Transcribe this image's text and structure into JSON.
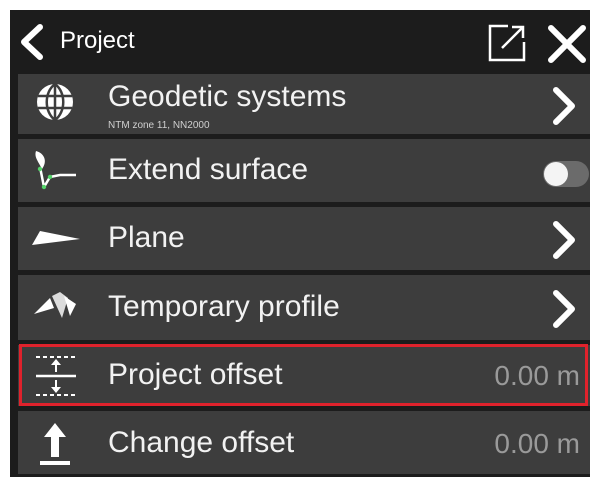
{
  "header": {
    "title": "Project",
    "back_icon": "chevron-left-icon",
    "popout_icon": "external-link-icon",
    "close_icon": "close-icon"
  },
  "items": [
    {
      "label": "Geodetic systems",
      "sublabel": "NTM zone 11, NN2000",
      "icon": "globe-icon",
      "action": "chevron"
    },
    {
      "label": "Extend surface",
      "icon": "extend-surface-icon",
      "action": "toggle",
      "toggle_on": false
    },
    {
      "label": "Plane",
      "icon": "plane-icon",
      "action": "chevron"
    },
    {
      "label": "Temporary profile",
      "icon": "profile-icon",
      "action": "chevron"
    },
    {
      "label": "Project offset",
      "icon": "offset-icon",
      "value": "0.00 m",
      "selected": true
    },
    {
      "label": "Change offset",
      "icon": "upload-arrow-icon",
      "value": "0.00 m"
    }
  ],
  "colors": {
    "background": "#1c1c1c",
    "row": "#3d3d3d",
    "highlight": "#e0222c",
    "text": "#f2f2f2",
    "value_text": "#9a9a9a"
  }
}
